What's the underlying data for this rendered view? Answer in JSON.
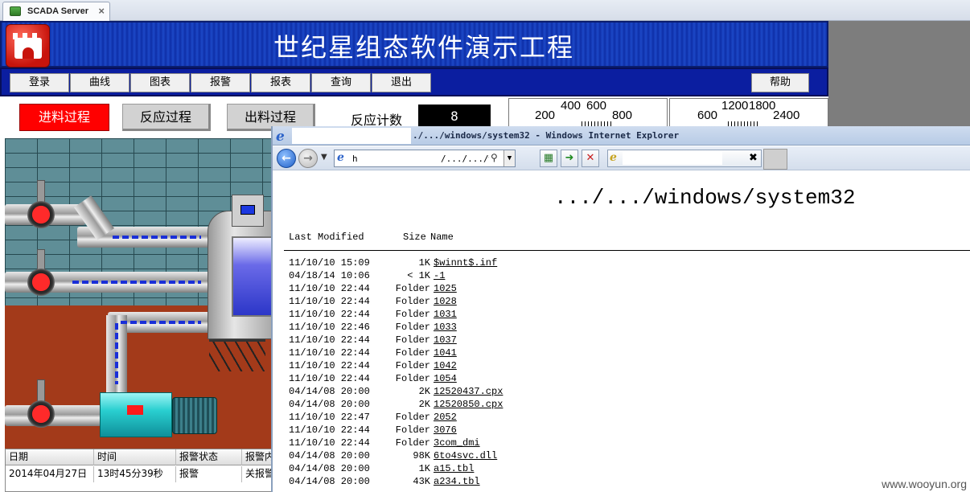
{
  "browser_tab": {
    "title": "SCADA Server",
    "close": "×"
  },
  "app": {
    "title": "世纪星组态软件演示工程",
    "menu": [
      {
        "label": "登录"
      },
      {
        "label": "曲线"
      },
      {
        "label": "图表"
      },
      {
        "label": "报警"
      },
      {
        "label": "报表"
      },
      {
        "label": "查询"
      },
      {
        "label": "退出"
      }
    ],
    "help": "帮助",
    "processes": [
      "进料过程",
      "反应过程",
      "出料过程"
    ],
    "counter_label": "反应计数",
    "counter_value": "8",
    "gauge1_ticks": [
      "200",
      "400",
      "600",
      "800"
    ],
    "gauge2_ticks": [
      "600",
      "1200",
      "1800",
      "2400"
    ]
  },
  "alarm_table": {
    "headers": [
      "日期",
      "时间",
      "报警状态",
      "报警内"
    ],
    "row": [
      "2014年04月27日",
      "13时45分39秒",
      "报警",
      "关报警"
    ]
  },
  "ie": {
    "title_suffix": "./.../windows/system32 - Windows Internet Explorer",
    "address_prefix": "h",
    "address_suffix": "/.../.../win",
    "heading": ".../.../windows/system32",
    "col_modified": "Last Modified",
    "col_size": "Size",
    "col_name": "Name",
    "listing": [
      {
        "date": "11/10/10 15:09",
        "size": "1K",
        "name": "$winnt$.inf"
      },
      {
        "date": "04/18/14 10:06",
        "size": "< 1K",
        "name": "-1"
      },
      {
        "date": "11/10/10 22:44",
        "size": "Folder",
        "name": "1025"
      },
      {
        "date": "11/10/10 22:44",
        "size": "Folder",
        "name": "1028"
      },
      {
        "date": "11/10/10 22:44",
        "size": "Folder",
        "name": "1031"
      },
      {
        "date": "11/10/10 22:46",
        "size": "Folder",
        "name": "1033"
      },
      {
        "date": "11/10/10 22:44",
        "size": "Folder",
        "name": "1037"
      },
      {
        "date": "11/10/10 22:44",
        "size": "Folder",
        "name": "1041"
      },
      {
        "date": "11/10/10 22:44",
        "size": "Folder",
        "name": "1042"
      },
      {
        "date": "11/10/10 22:44",
        "size": "Folder",
        "name": "1054"
      },
      {
        "date": "04/14/08 20:00",
        "size": "2K",
        "name": "12520437.cpx"
      },
      {
        "date": "04/14/08 20:00",
        "size": "2K",
        "name": "12520850.cpx"
      },
      {
        "date": "11/10/10 22:47",
        "size": "Folder",
        "name": "2052"
      },
      {
        "date": "11/10/10 22:44",
        "size": "Folder",
        "name": "3076"
      },
      {
        "date": "11/10/10 22:44",
        "size": "Folder",
        "name": "3com_dmi"
      },
      {
        "date": "04/14/08 20:00",
        "size": "98K",
        "name": "6to4svc.dll"
      },
      {
        "date": "04/14/08 20:00",
        "size": "1K",
        "name": "a15.tbl"
      },
      {
        "date": "04/14/08 20:00",
        "size": "43K",
        "name": "a234.tbl"
      }
    ]
  },
  "watermark": "www.wooyun.org"
}
